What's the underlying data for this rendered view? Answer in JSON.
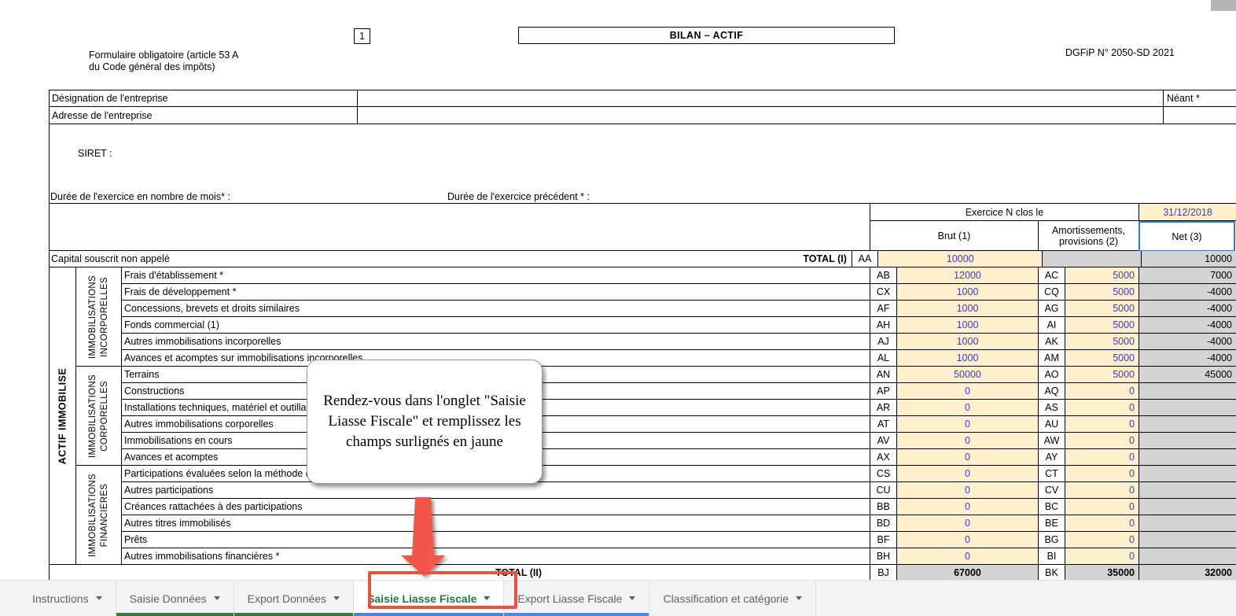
{
  "header": {
    "page_number": "1",
    "form_note": "Formulaire obligatoire (article 53 A\n du Code général des impôts)",
    "title": "BILAN – ACTIF",
    "dgfip": "DGFiP N° 2050-SD 2021"
  },
  "identity": {
    "designation_label": "Désignation de l'entreprise",
    "adresse_label": "Adresse de l'entreprise",
    "neant_label": "Néant  *",
    "siret_label": "SIRET :",
    "duree_exercice_label": "Durée de l'exercice en nombre de mois* :",
    "duree_precedent_label": "Durée de l'exercice précédent *  :"
  },
  "table": {
    "exercice_header": "Exercice N clos le",
    "exercice_date": "31/12/2018",
    "col_brut": "Brut (1)",
    "col_amort": "Amortissements, provisions (2)",
    "col_net": "Net (3)",
    "capital_label": "Capital souscrit non appelé",
    "total_1": "TOTAL (I)",
    "total_2": "TOTAL (II)",
    "side_label": "ACTIF IMMOBILISE",
    "groups": [
      {
        "name": "IMMOBILISATIONS\nINCORPORELLES",
        "rows": 6
      },
      {
        "name": "IMMOBILISATIONS\nCORPORELLES",
        "rows": 6
      },
      {
        "name": "IMMOBILISATIONS\nFINANCIERES",
        "rows": 6
      }
    ],
    "capital_row": {
      "code_brut": "AA",
      "brut": "10000",
      "net": "10000"
    },
    "rows": [
      {
        "label": "Frais d'établissement *",
        "code_brut": "AB",
        "brut": "12000",
        "code_amort": "AC",
        "amort": "5000",
        "net": "7000"
      },
      {
        "label": "Frais de développement *",
        "code_brut": "CX",
        "brut": "1000",
        "code_amort": "CQ",
        "amort": "5000",
        "net": "-4000"
      },
      {
        "label": "Concessions, brevets et droits similaires",
        "code_brut": "AF",
        "brut": "1000",
        "code_amort": "AG",
        "amort": "5000",
        "net": "-4000"
      },
      {
        "label": "Fonds commercial (1)",
        "code_brut": "AH",
        "brut": "1000",
        "code_amort": "AI",
        "amort": "5000",
        "net": "-4000"
      },
      {
        "label": "Autres immobilisations incorporelles",
        "code_brut": "AJ",
        "brut": "1000",
        "code_amort": "AK",
        "amort": "5000",
        "net": "-4000"
      },
      {
        "label": "Avances et acomptes sur immobilisations incorporelles",
        "code_brut": "AL",
        "brut": "1000",
        "code_amort": "AM",
        "amort": "5000",
        "net": "-4000"
      },
      {
        "label": "Terrains",
        "code_brut": "AN",
        "brut": "50000",
        "code_amort": "AO",
        "amort": "5000",
        "net": "45000"
      },
      {
        "label": "Constructions",
        "code_brut": "AP",
        "brut": "0",
        "code_amort": "AQ",
        "amort": "0",
        "net": ""
      },
      {
        "label": "Installations techniques, matériel et outillage industriels",
        "code_brut": "AR",
        "brut": "0",
        "code_amort": "AS",
        "amort": "0",
        "net": ""
      },
      {
        "label": "Autres immobilisations corporelles",
        "code_brut": "AT",
        "brut": "0",
        "code_amort": "AU",
        "amort": "0",
        "net": ""
      },
      {
        "label": "Immobilisations en cours",
        "code_brut": "AV",
        "brut": "0",
        "code_amort": "AW",
        "amort": "0",
        "net": ""
      },
      {
        "label": "Avances et acomptes",
        "code_brut": "AX",
        "brut": "0",
        "code_amort": "AY",
        "amort": "0",
        "net": ""
      },
      {
        "label": "Participations évaluées selon la méthode de mise en équivalence",
        "code_brut": "CS",
        "brut": "0",
        "code_amort": "CT",
        "amort": "0",
        "net": ""
      },
      {
        "label": "Autres participations",
        "code_brut": "CU",
        "brut": "0",
        "code_amort": "CV",
        "amort": "0",
        "net": ""
      },
      {
        "label": "Créances rattachées à des participations",
        "code_brut": "BB",
        "brut": "0",
        "code_amort": "BC",
        "amort": "0",
        "net": ""
      },
      {
        "label": "Autres titres immobilisés",
        "code_brut": "BD",
        "brut": "0",
        "code_amort": "BE",
        "amort": "0",
        "net": ""
      },
      {
        "label": "Prêts",
        "code_brut": "BF",
        "brut": "0",
        "code_amort": "BG",
        "amort": "0",
        "net": ""
      },
      {
        "label": "Autres immobilisations financières *",
        "code_brut": "BH",
        "brut": "0",
        "code_amort": "BI",
        "amort": "0",
        "net": ""
      }
    ],
    "total_row": {
      "code_brut": "BJ",
      "brut": "67000",
      "code_amort": "BK",
      "amort": "35000",
      "net": "32000"
    }
  },
  "callout": {
    "text": "Rendez-vous dans l'onglet \"Saisie Liasse Fiscale\" et remplissez les champs surlignés en jaune"
  },
  "tabs": [
    {
      "label": "Instructions",
      "underline": "#f1f3f4",
      "active": false
    },
    {
      "label": "Saisie Données",
      "underline": "#2e7d32",
      "active": false
    },
    {
      "label": "Export Données",
      "underline": "#2e7d32",
      "active": false
    },
    {
      "label": "Saisie Liasse Fiscale",
      "underline": "#4285f4",
      "active": true
    },
    {
      "label": "Export Liasse Fiscale",
      "underline": "#4285f4",
      "active": false
    },
    {
      "label": "Classification et catégorie",
      "underline": "#f1f3f4",
      "active": false
    }
  ],
  "annotations": {
    "arrow_color": "#f4554a",
    "highlight_color": "#e8523f"
  }
}
